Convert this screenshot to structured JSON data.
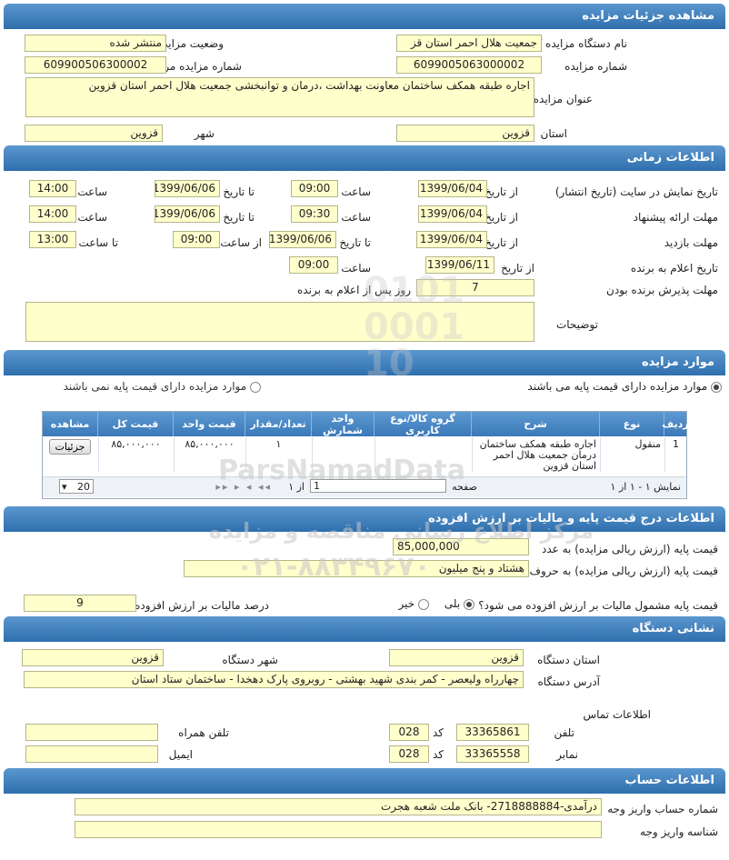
{
  "sections": {
    "details": "مشاهده جزئیات مزایده",
    "time": "اطلاعات زمانی",
    "items": "موارد مزایده",
    "price": "اطلاعات درج قیمت پایه و مالیات بر ارزش افزوده",
    "org_address": "نشانی دستگاه",
    "account": "اطلاعات حساب"
  },
  "details": {
    "org_label": "نام دستگاه مزایده گزار",
    "org_value": "جمعیت هلال احمر استان قز",
    "status_label": "وضعیت مزایده",
    "status_value": "منتشر شده",
    "number_label": "شماره مزایده",
    "number_value": "6099005063000002",
    "ref_label": "شماره مزایده مرجع",
    "ref_value": "609900506300002",
    "title_label": "عنوان مزایده",
    "title_value": "اجاره طبقه همکف  ساختمان معاونت بهداشت ،درمان و توانبخشی جمعیت هلال احمر استان قزوین",
    "province_label": "استان",
    "province_value": "قزوین",
    "city_label": "شهر",
    "city_value": "قزوین"
  },
  "time": {
    "publish_label": "تاریخ نمایش در سایت (تاریخ انتشار)",
    "offer_label": "مهلت ارائه پیشنهاد",
    "visit_label": "مهلت بازدید",
    "winner_label": "تاریخ اعلام به برنده",
    "accept_label": "مهلت پذیرش برنده بودن",
    "desc_label": "توضیحات",
    "from_date": "از تاریخ",
    "to_date": "تا تاریخ",
    "hour": "ساعت",
    "from_hour": "از ساعت",
    "to_hour": "تا ساعت",
    "publish": {
      "from": "1399/06/04",
      "from_time": "09:00",
      "to": "1399/06/06",
      "to_time": "14:00"
    },
    "offer": {
      "from": "1399/06/04",
      "from_time": "09:30",
      "to": "1399/06/06",
      "to_time": "14:00"
    },
    "visit": {
      "from": "1399/06/04",
      "to": "1399/06/06",
      "from_time": "09:00",
      "to_time": "13:00"
    },
    "winner": {
      "date": "1399/06/11",
      "time": "09:00"
    },
    "accept_days": "7",
    "accept_suffix": "روز پس از اعلام به برنده",
    "description": ""
  },
  "items": {
    "radio_with": "موارد مزایده دارای قیمت پایه می باشند",
    "radio_without": "موارد مزایده دارای قیمت پایه نمی باشند",
    "columns": [
      "ردیف",
      "نوع",
      "شرح",
      "گروه کالا/نوع کاربری",
      "واحد شمارش",
      "تعداد/مقدار",
      "قیمت واحد",
      "قیمت کل",
      "مشاهده"
    ],
    "row": {
      "index": "1",
      "type": "منقول",
      "desc": "اجاره طبقه همکف ساختمان درمان جمعیت هلال احمر استان قزوین",
      "group": "",
      "unit": "",
      "qty": "۱",
      "unit_price": "۸۵,۰۰۰,۰۰۰",
      "total": "۸۵,۰۰۰,۰۰۰",
      "view_button": "جزئیات"
    },
    "pager": {
      "summary": "نمایش ۱ - ۱ از ۱",
      "page_label": "صفحه",
      "page_value": "1",
      "of_label": "از ۱",
      "page_size": "20"
    }
  },
  "price": {
    "base_num_label": "قیمت پایه (ارزش ریالی مزایده) به عدد",
    "base_num_value": "85,000,000",
    "base_word_label": "قیمت پایه (ارزش ریالی مزایده) به حروف",
    "base_word_value": "هشتاد و پنج میلیون",
    "vat_question": "قیمت پایه مشمول مالیات بر ارزش افزوده می شود؟",
    "yes": "بلی",
    "no": "خیر",
    "vat_percent_label": "درصد مالیات بر ارزش افزوده",
    "vat_percent_value": "9"
  },
  "address": {
    "province_label": "استان دستگاه",
    "province_value": "قزوین",
    "city_label": "شهر دستگاه",
    "city_value": "قزوین",
    "addr_label": "آدرس دستگاه",
    "addr_value": "چهارراه ولیعصر - کمر بندی شهید بهشتی - روبروی پارک دهخدا - ساختمان ستاد استان",
    "contact_label": "اطلاعات تماس",
    "phone_label": "تلفن",
    "phone_value": "33365861",
    "code_label": "کد",
    "phone_code": "028",
    "mobile_label": "تلفن همراه",
    "mobile_value": "",
    "fax_label": "نمابر",
    "fax_value": "33365558",
    "fax_code": "028",
    "email_label": "ایمیل",
    "email_value": ""
  },
  "account": {
    "number_label": "شماره حساب واریز وجه",
    "number_value": "درآمدی-2718888884- بانک ملت شعبه هجرت",
    "id_label": "شناسه واریز وجه",
    "id_value": ""
  },
  "watermark": {
    "brand": "ParsNamadData",
    "line1": "مرکز اطلاع رسانی مناقصه و مزایده",
    "phone": "۰۲۱-۸۸۳۴۹۶۷۰"
  },
  "colors": {
    "header": "#2f6fad",
    "field": "#ffffcc"
  }
}
